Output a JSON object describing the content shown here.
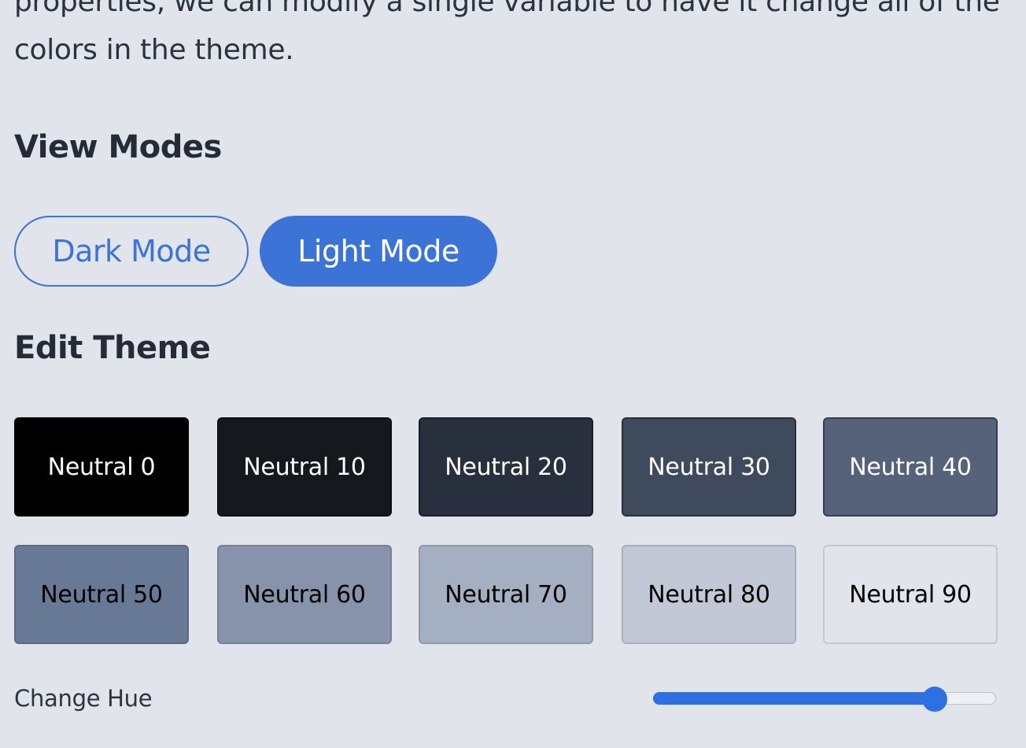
{
  "intro_text": "properties, we can modify a single variable to have it change all of the colors in the theme.",
  "view_modes": {
    "heading": "View Modes",
    "dark_label": "Dark Mode",
    "light_label": "Light Mode",
    "active": "light"
  },
  "edit_theme": {
    "heading": "Edit Theme",
    "swatches": [
      {
        "label": "Neutral 0",
        "color": "#000000",
        "text_color": "#ffffff"
      },
      {
        "label": "Neutral 10",
        "color": "#15181d",
        "text_color": "#ffffff"
      },
      {
        "label": "Neutral 20",
        "color": "#29303d",
        "text_color": "#ffffff"
      },
      {
        "label": "Neutral 30",
        "color": "#3f4a5d",
        "text_color": "#ffffff"
      },
      {
        "label": "Neutral 40",
        "color": "#55627a",
        "text_color": "#ffffff"
      },
      {
        "label": "Neutral 50",
        "color": "#677994",
        "text_color": "#000000"
      },
      {
        "label": "Neutral 60",
        "color": "#8693aa",
        "text_color": "#000000"
      },
      {
        "label": "Neutral 70",
        "color": "#a4afc1",
        "text_color": "#000000"
      },
      {
        "label": "Neutral 80",
        "color": "#c2c8d5",
        "text_color": "#000000"
      },
      {
        "label": "Neutral 90",
        "color": "#e1e4ea",
        "text_color": "#000000"
      }
    ]
  },
  "hue": {
    "label": "Change Hue",
    "value_fraction": 0.82
  },
  "colors": {
    "accent": "#3b73d6",
    "slider": "#2f6fe4",
    "background": "#e1e4ea"
  }
}
